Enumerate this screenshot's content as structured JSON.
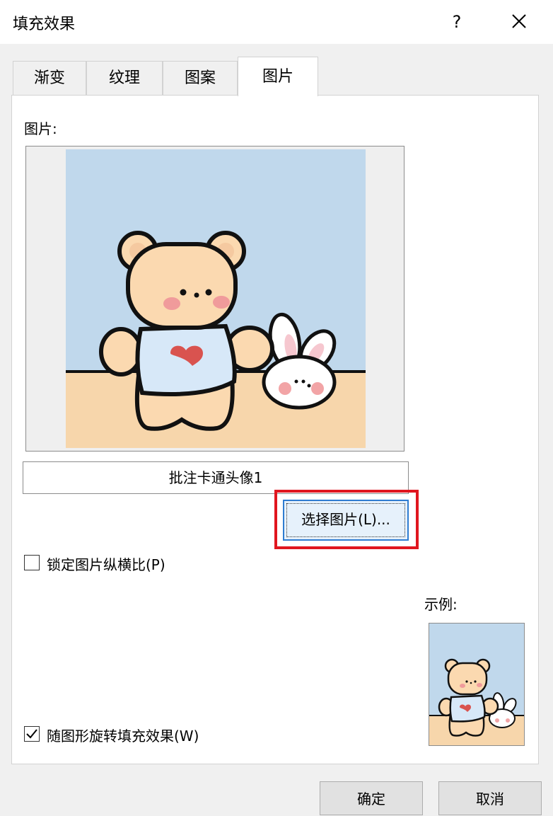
{
  "dialog": {
    "title": "填充效果",
    "help_label": "?"
  },
  "tabs": [
    {
      "label": "渐变"
    },
    {
      "label": "纹理"
    },
    {
      "label": "图案"
    },
    {
      "label": "图片"
    }
  ],
  "picture_tab": {
    "picture_label": "图片:",
    "picture_name": "批注卡通头像1",
    "select_button_label": "选择图片(L)...",
    "lock_aspect_label": "锁定图片纵横比(P)",
    "lock_aspect_checked": false,
    "sample_label": "示例:",
    "rotate_label": "随图形旋转填充效果(W)",
    "rotate_checked": true
  },
  "footer": {
    "ok_label": "确定",
    "cancel_label": "取消"
  },
  "colors": {
    "highlight": "#e0161f",
    "sky": "#c0d8ec",
    "floor": "#f7d6ab",
    "bear": "#fbd9b0",
    "shirt": "#d7e8f8",
    "heart": "#d9534f"
  }
}
